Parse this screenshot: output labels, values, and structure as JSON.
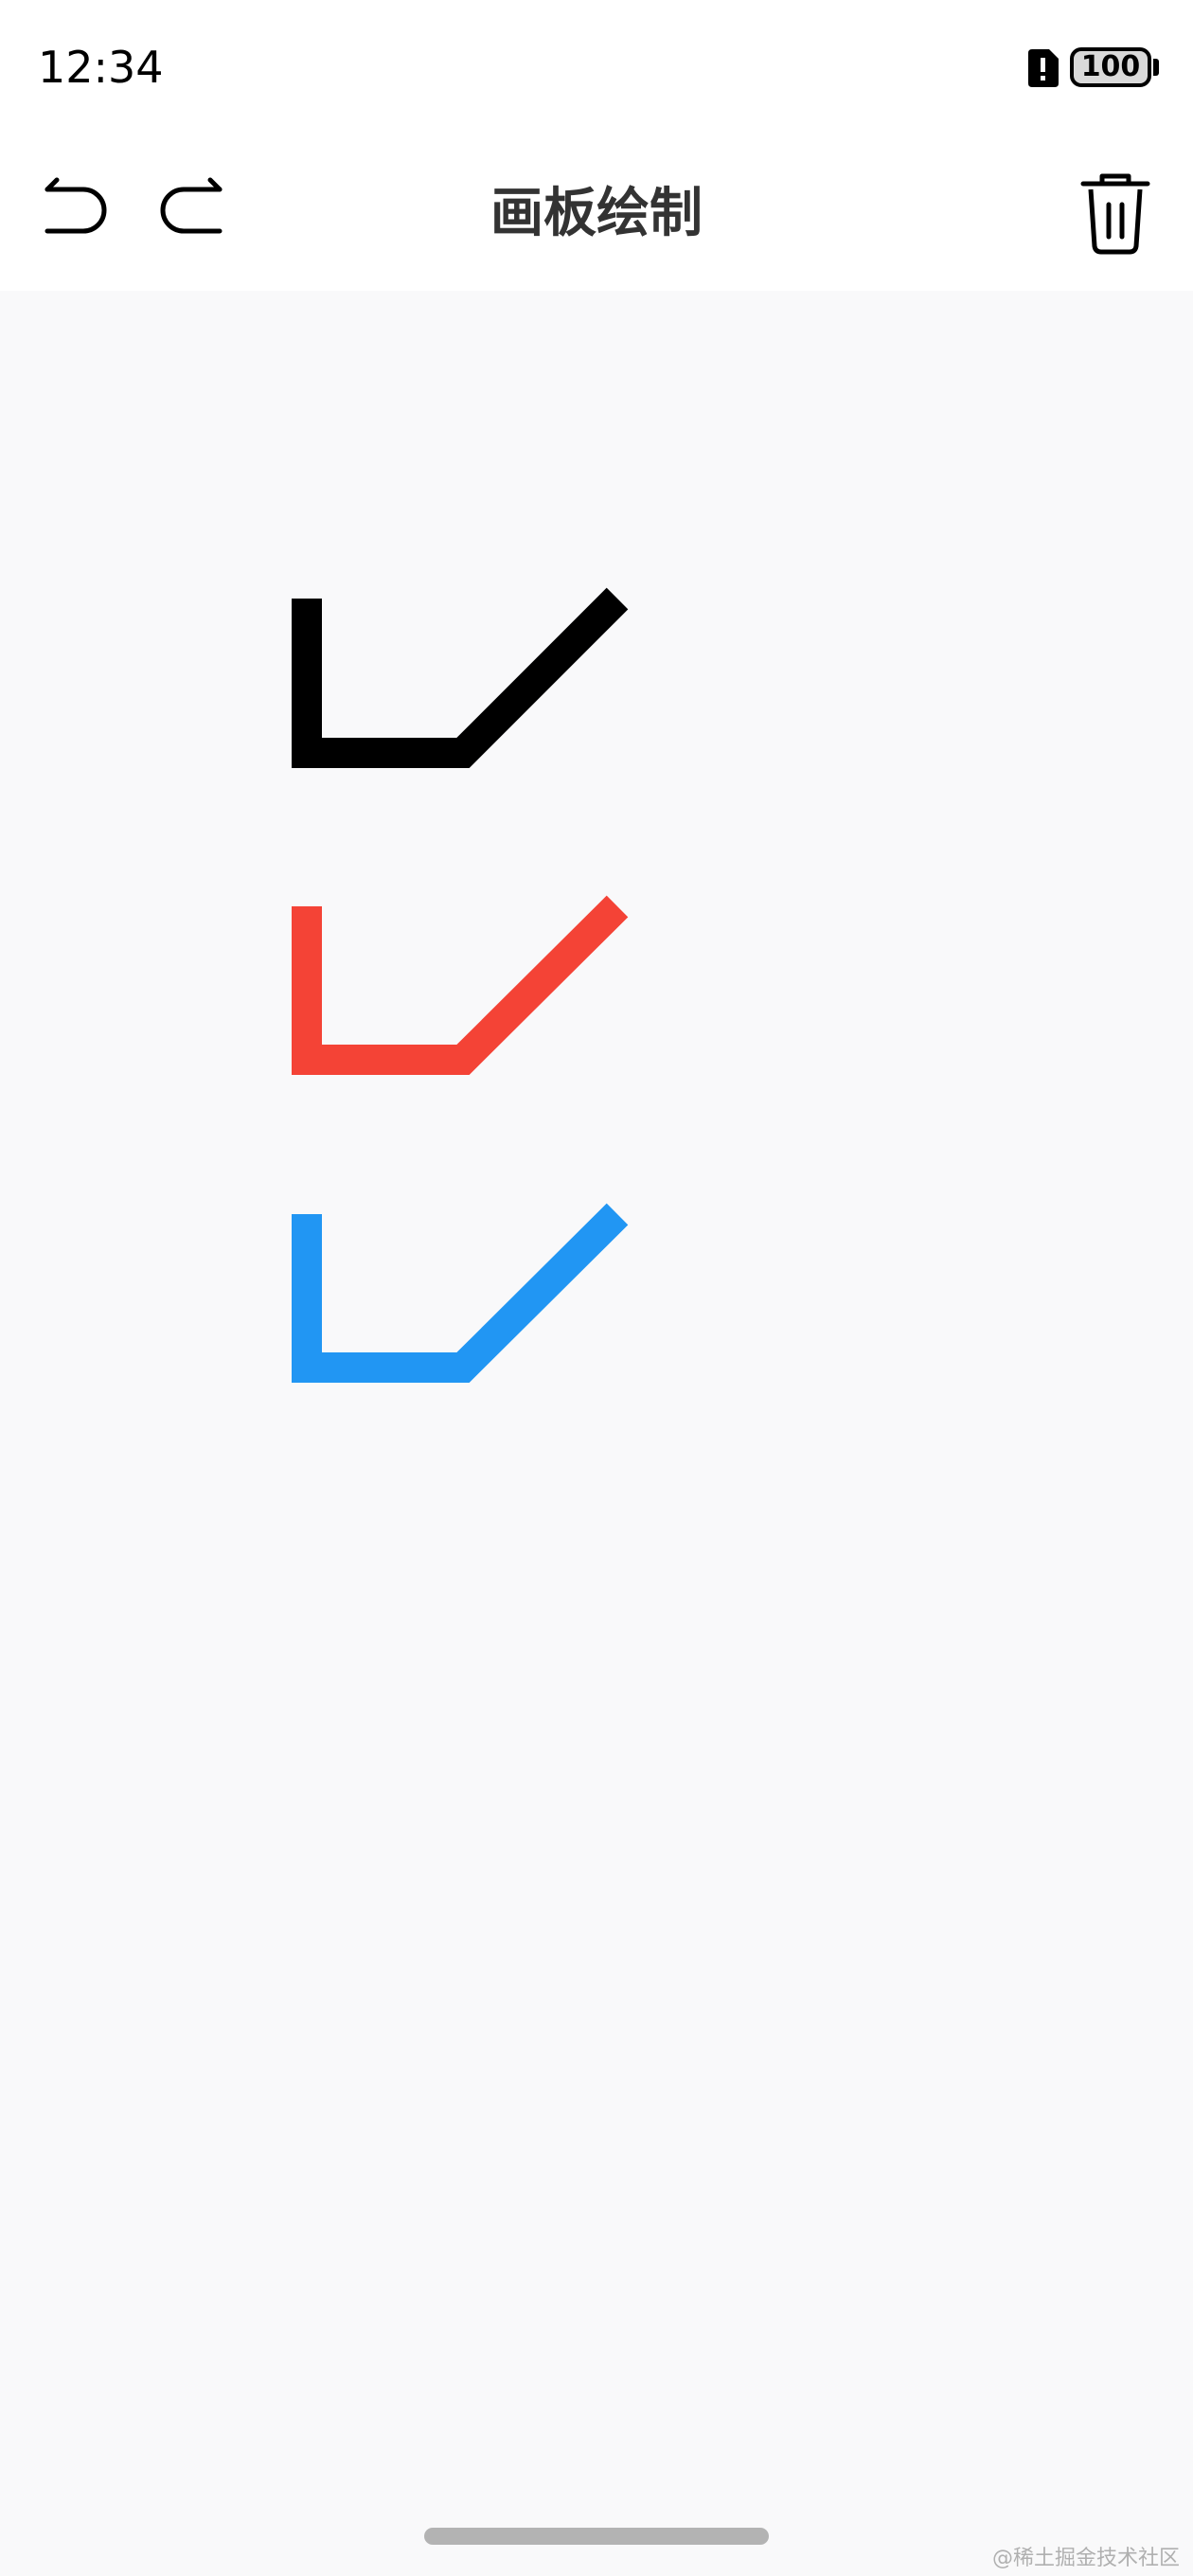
{
  "status_bar": {
    "time": "12:34",
    "battery_level": "100",
    "alert_icon": "sim-alert-icon"
  },
  "app_bar": {
    "title": "画板绘制",
    "undo_icon": "undo-icon",
    "redo_icon": "redo-icon",
    "clear_icon": "trash-icon"
  },
  "canvas": {
    "background_color": "#f9f9fa",
    "strokes": [
      {
        "name": "black-stroke",
        "color": "#000000"
      },
      {
        "name": "red-stroke",
        "color": "#f44336"
      },
      {
        "name": "blue-stroke",
        "color": "#2196f3"
      }
    ]
  },
  "watermark": "@稀土掘金技术社区"
}
